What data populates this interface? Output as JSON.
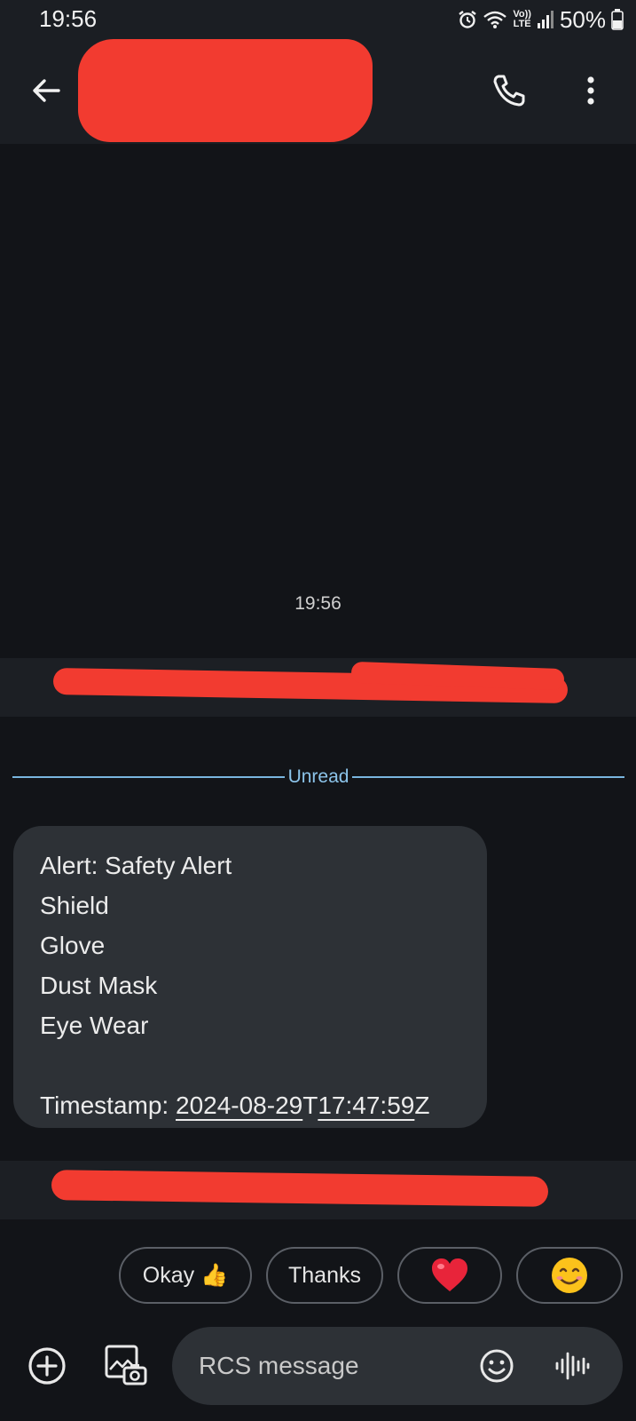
{
  "status_bar": {
    "time": "19:56",
    "network_top": "Vo))",
    "network_bottom": "LTE",
    "battery": "50%"
  },
  "app_bar": {
    "icons": [
      "back-arrow-icon",
      "phone-icon",
      "more-vert-icon"
    ]
  },
  "conversation": {
    "timestamp": "19:56",
    "unread_label": "Unread",
    "message_lines": [
      "Alert: Safety Alert",
      "Shield",
      "Glove",
      "Dust Mask",
      "Eye Wear",
      ""
    ],
    "timestamp_line": {
      "prefix": "Timestamp: ",
      "date": "2024-08-29",
      "sep": "T",
      "time": "17:47:59",
      "suffix": "Z"
    }
  },
  "smart_replies": [
    {
      "label": "Okay",
      "emoji": "👍"
    },
    {
      "label": "Thanks"
    },
    {
      "emoji": "❤️"
    },
    {
      "emoji": "😊"
    }
  ],
  "composer": {
    "placeholder": "RCS message",
    "icons": [
      "add-circle-icon",
      "gallery-icon",
      "emoji-icon",
      "voice-icon"
    ]
  },
  "colors": {
    "background": "#121418",
    "bar": "#1b1e23",
    "bubble": "#2d3136",
    "unread_accent": "#79b5df",
    "redaction": "#f23b30"
  }
}
